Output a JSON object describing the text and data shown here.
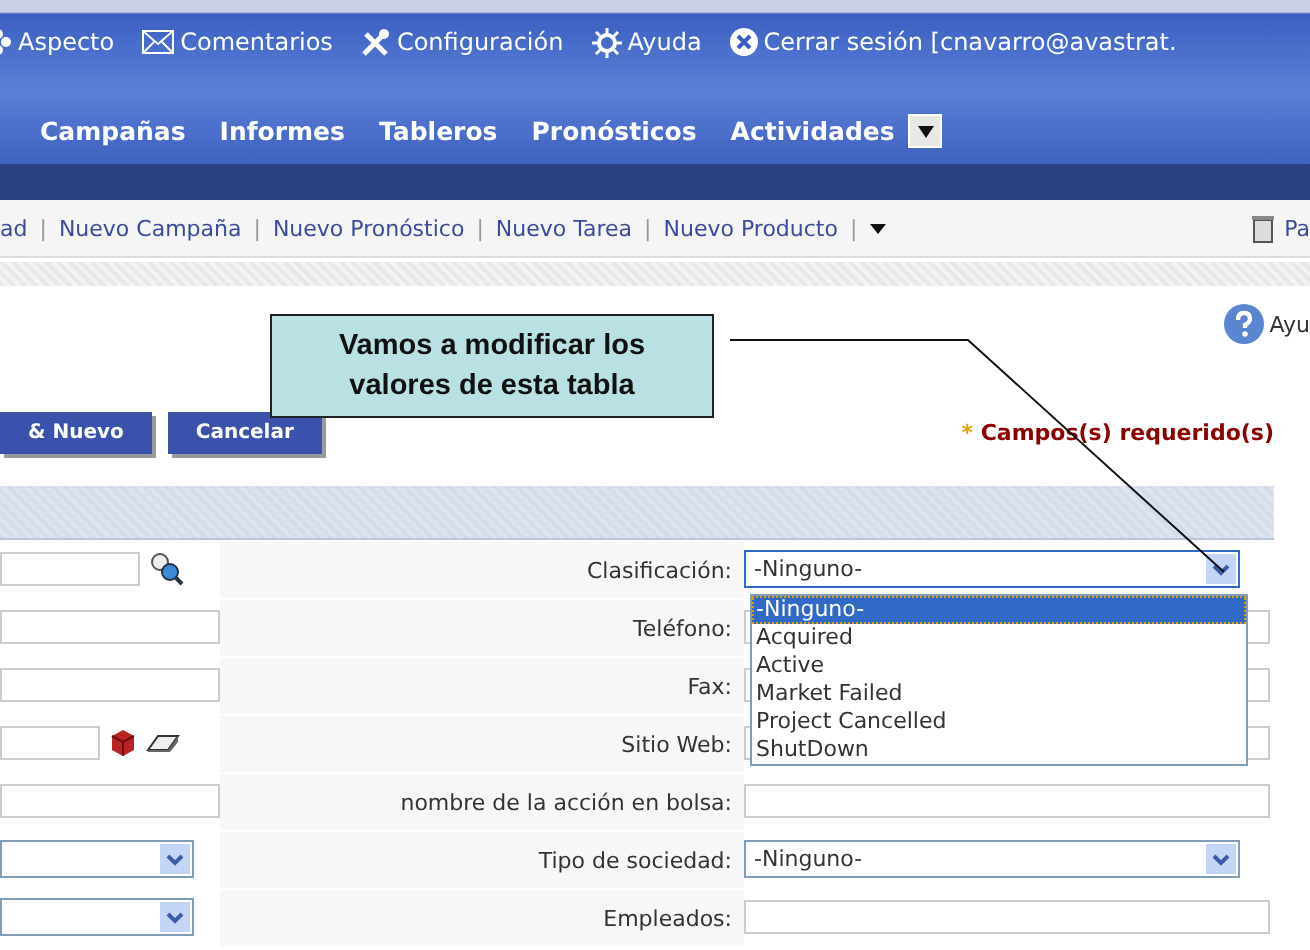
{
  "top_links": [
    {
      "label": "Aspecto",
      "kind": "flower"
    },
    {
      "label": "Comentarios",
      "kind": "mail"
    },
    {
      "label": "Configuración",
      "kind": "tools"
    },
    {
      "label": "Ayuda",
      "kind": "sun"
    },
    {
      "label": "Cerrar sesión [cnavarro@avastrat.",
      "kind": "close"
    }
  ],
  "tabs": [
    {
      "label": "Campañas"
    },
    {
      "label": "Informes"
    },
    {
      "label": "Tableros"
    },
    {
      "label": "Pronósticos"
    },
    {
      "label": "Actividades"
    }
  ],
  "toolbar_items": [
    {
      "kind": "link",
      "label": "ad"
    },
    {
      "kind": "separator",
      "label": "|"
    },
    {
      "kind": "link",
      "label": "Nuevo Campaña"
    },
    {
      "kind": "separator",
      "label": "|"
    },
    {
      "kind": "link",
      "label": "Nuevo Pronóstico"
    },
    {
      "kind": "separator",
      "label": "|"
    },
    {
      "kind": "link",
      "label": "Nuevo Tarea"
    },
    {
      "kind": "separator",
      "label": "|"
    },
    {
      "kind": "link",
      "label": "Nuevo Producto"
    },
    {
      "kind": "separator",
      "label": "|"
    }
  ],
  "toolbar_right": "Pa",
  "help_link": "Ayu",
  "buttons": [
    "& Nuevo",
    "Cancelar"
  ],
  "required_note": {
    "mark": "*",
    "text": "Campos(s) requerido(s)"
  },
  "callout": "Vamos a modificar los valores de esta tabla",
  "left_fields": [
    {
      "kind": "lookup"
    },
    {
      "kind": "text"
    },
    {
      "kind": "text"
    },
    {
      "kind": "lookup_clear"
    },
    {
      "kind": "text"
    },
    {
      "kind": "select"
    },
    {
      "kind": "select"
    }
  ],
  "right_fields": [
    {
      "label": "Clasificación:",
      "kind": "select",
      "value": "-Ninguno-",
      "expanded": true
    },
    {
      "label": "Teléfono:",
      "kind": "text"
    },
    {
      "label": "Fax:",
      "kind": "text"
    },
    {
      "label": "Sitio Web:",
      "kind": "text"
    },
    {
      "label": "nombre de la acción en bolsa:",
      "kind": "text"
    },
    {
      "label": "Tipo de sociedad:",
      "kind": "select",
      "value": "-Ninguno-",
      "expanded": false
    },
    {
      "label": "Empleados:",
      "kind": "text"
    }
  ],
  "dropdown_options": [
    {
      "label": "-Ninguno-",
      "selected": true
    },
    {
      "label": "Acquired",
      "selected": false
    },
    {
      "label": "Active",
      "selected": false
    },
    {
      "label": "Market Failed",
      "selected": false
    },
    {
      "label": "Project Cancelled",
      "selected": false
    },
    {
      "label": "ShutDown",
      "selected": false
    }
  ]
}
